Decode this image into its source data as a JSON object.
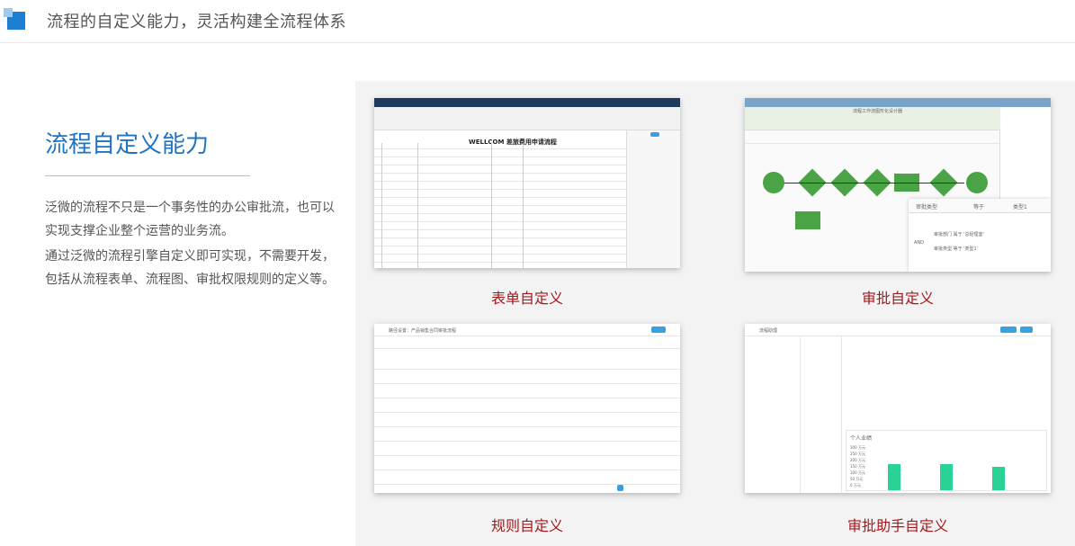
{
  "header": {
    "title": "流程的自定义能力，灵活构建全流程体系"
  },
  "intro": {
    "heading": "流程自定义能力",
    "para1": "泛微的流程不只是一个事务性的办公审批流，也可以实现支撑企业整个运营的业务流。",
    "para2": "通过泛微的流程引擎自定义即可实现，不需要开发，包括从流程表单、流程图、审批权限规则的定义等。"
  },
  "cards": {
    "form": {
      "caption": "表单自定义",
      "sheet_title": "WELLCOM 差旅费用申请流程"
    },
    "approve": {
      "caption": "审批自定义",
      "window_title": "流程工作流图形化设计器",
      "filter_field": "审批类型",
      "filter_op": "等于",
      "filter_value": "类型1",
      "cond1": "审批部门 属于 '总经理室'",
      "cond2": "审批类型 等于 '类型1'",
      "logic": "AND"
    },
    "rule": {
      "caption": "规则自定义",
      "window_title": "路径设置：产品销售合同审批流程"
    },
    "assist": {
      "caption": "审批助手自定义",
      "window_title": "流程助理",
      "chart_title": "个人业绩",
      "y_ticks": [
        "300 万元",
        "250 万元",
        "200 万元",
        "150 万元",
        "100 万元",
        "50 万元",
        "0 万元"
      ]
    }
  },
  "colors": {
    "accent": "#1d74c4",
    "caption": "#a4191d",
    "flow": "#4aa446",
    "bar": "#2bd295"
  }
}
